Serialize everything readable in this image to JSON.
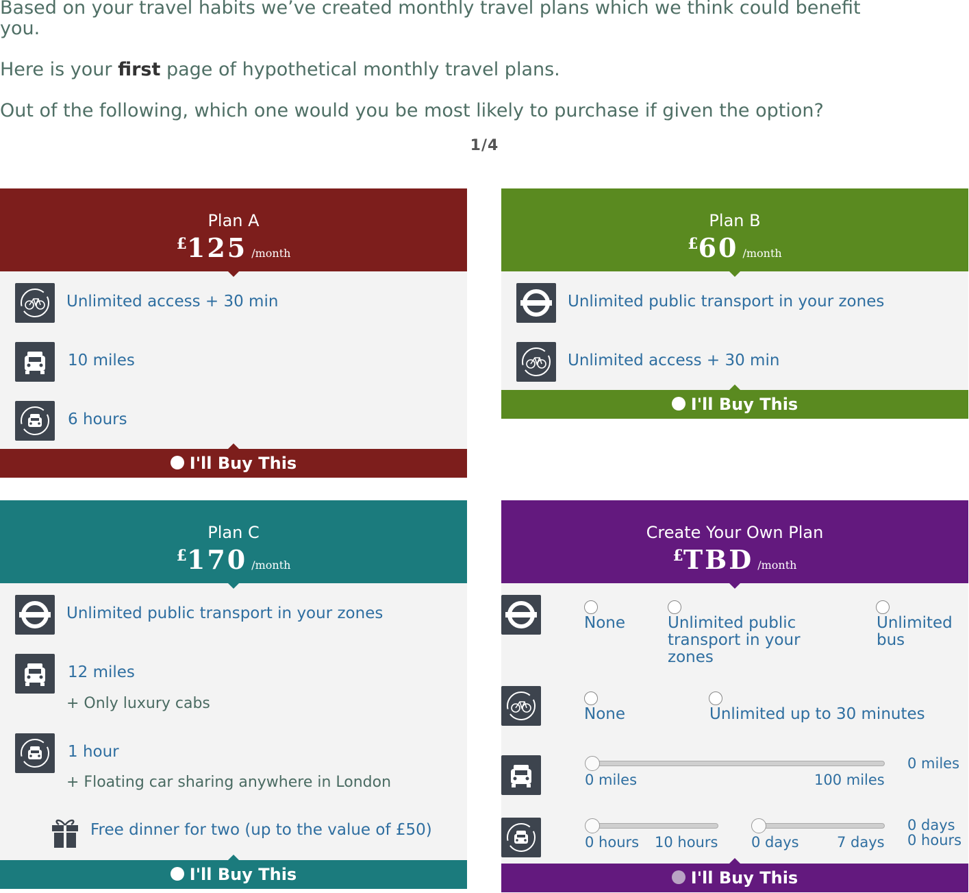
{
  "intro": {
    "line1": "Based on your travel habits we’ve created monthly travel plans which we think could benefit",
    "line1b": "you.",
    "line2_pre": "Here is your ",
    "line2_bold": "first",
    "line2_post": " page of hypothetical monthly travel plans.",
    "line3": "Out of the following, which one would you be most likely to purchase if given the option?",
    "page_counter": "1/4"
  },
  "colors": {
    "plan_a": "#7d1e1c",
    "plan_b": "#5a8a20",
    "plan_c": "#1b7b7d",
    "plan_custom": "#63197e"
  },
  "plans": {
    "a": {
      "name": "Plan A",
      "currency": "£",
      "amount": "125",
      "per": "/month",
      "features": [
        {
          "icon": "bike-icon",
          "text": "Unlimited access + 30 min"
        },
        {
          "icon": "taxi-icon",
          "text": "10 miles"
        },
        {
          "icon": "car-share-icon",
          "text": "6 hours"
        }
      ],
      "buy_label": "I'll Buy This"
    },
    "b": {
      "name": "Plan B",
      "currency": "£",
      "amount": "60",
      "per": "/month",
      "features": [
        {
          "icon": "underground-icon",
          "text": "Unlimited public transport in your zones"
        },
        {
          "icon": "bike-icon",
          "text": "Unlimited access + 30 min"
        }
      ],
      "buy_label": "I'll Buy This"
    },
    "c": {
      "name": "Plan C",
      "currency": "£",
      "amount": "170",
      "per": "/month",
      "features": [
        {
          "icon": "underground-icon",
          "text": "Unlimited public transport in your zones"
        },
        {
          "icon": "taxi-icon",
          "text": "12 miles",
          "sub": "+ Only luxury cabs"
        },
        {
          "icon": "car-share-icon",
          "text": "1 hour",
          "sub": "+ Floating car sharing anywhere in London"
        },
        {
          "icon": "gift-icon",
          "text": "Free dinner for two (up to the value of £50)"
        }
      ],
      "buy_label": "I'll Buy This"
    },
    "custom": {
      "name": "Create Your Own Plan",
      "currency": "£",
      "amount": "TBD",
      "per": "/month",
      "transport_options": [
        "None",
        "Unlimited public transport in your zones",
        "Unlimited bus"
      ],
      "bike_options": [
        "None",
        "Unlimited up to 30 minutes"
      ],
      "taxi_slider": {
        "min_label": "0 miles",
        "max_label": "100 miles",
        "value_label": "0 miles",
        "value": 0
      },
      "car_hours_slider": {
        "min_label": "0 hours",
        "max_label": "10 hours",
        "value": 0
      },
      "car_days_slider": {
        "min_label": "0 days",
        "max_label": "7 days",
        "value": 0
      },
      "car_value_days": "0 days",
      "car_value_hours": "0 hours",
      "buy_label": "I'll Buy This"
    }
  }
}
